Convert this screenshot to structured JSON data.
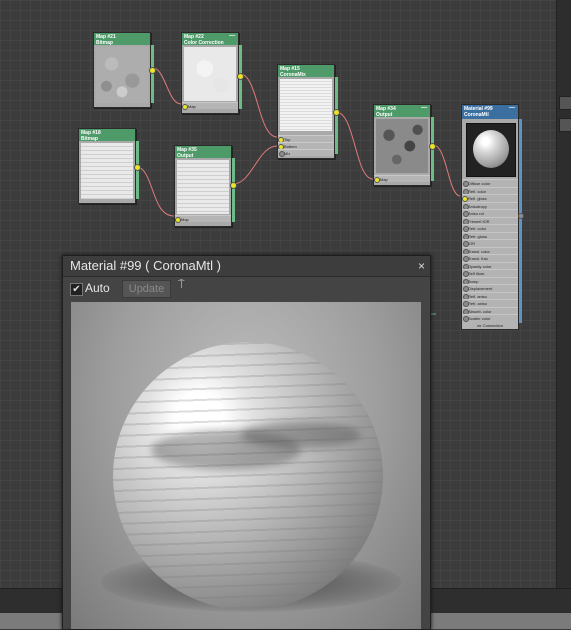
{
  "nodes": {
    "map21": {
      "title": "Map #21",
      "subtitle": "Bitmap"
    },
    "map22": {
      "title": "Map #22",
      "subtitle": "Color Correction",
      "slot_map": "Map"
    },
    "map15": {
      "title": "Map #15",
      "subtitle": "CoronaMix",
      "slots": [
        "Top",
        "Bottom",
        "Mix"
      ]
    },
    "map34": {
      "title": "Map #34",
      "subtitle": "Output",
      "slot_map": "Map"
    },
    "map18": {
      "title": "Map #18",
      "subtitle": "Bitmap"
    },
    "map35": {
      "title": "Map #35",
      "subtitle": "Output",
      "slot_map": "Map"
    },
    "material99": {
      "title": "Material #99",
      "subtitle": "CoronaMtl",
      "slots": [
        "Diffuse color",
        "Refl. color",
        "Refl. gloss",
        "Anisotropy",
        "Aniso rot",
        "Fresnel IOR",
        "Refr. color",
        "Refr. gloss",
        "IOR",
        "Transl. color",
        "Transl. frac",
        "Opacity color",
        "Self illum.",
        "Bump",
        "Displacement",
        "Refl. aniso",
        "Refr. aniso",
        "Absorb. color",
        "Scatter color"
      ],
      "footer": "mr Connection"
    }
  },
  "preview_window": {
    "title": "Material #99  ( CoronaMtl )",
    "close_glyph": "×",
    "auto_label": "Auto",
    "auto_checked": true,
    "checkbox_glyph": "✔",
    "update_label": "Update",
    "pin_glyph": "⍑"
  },
  "colors": {
    "map_header": "#4e9a68",
    "material_header": "#3b6fa0",
    "socket": "#e8e52a",
    "wire": "#e07a7a"
  }
}
